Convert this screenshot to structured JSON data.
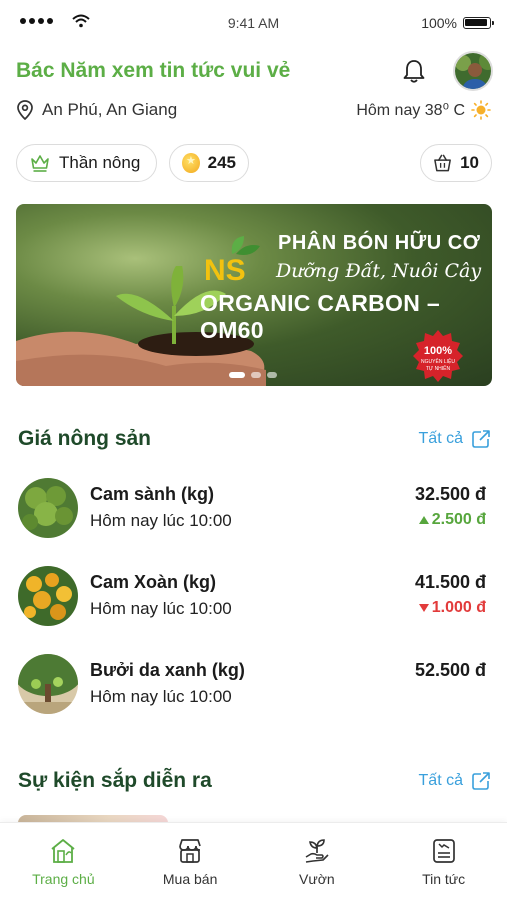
{
  "status": {
    "time": "9:41 AM",
    "battery": "100%"
  },
  "header": {
    "greeting": "Bác Năm xem tin tức vui vẻ",
    "location": "An Phú, An Giang",
    "weather": "Hôm nay 38⁰ C"
  },
  "chips": {
    "rank": "Thần nông",
    "coins": "245",
    "cart": "10"
  },
  "banner": {
    "title1": "PHÂN BÓN HỮU CƠ",
    "title2": "Dưỡng Đất, Nuôi Cây",
    "title3": "ORGANIC CARBON – OM60",
    "logo_text": "NS",
    "seal_line1": "100%",
    "seal_line2": "NGUYÊN LIỆU",
    "seal_line3": "TỰ NHIÊN",
    "active_slide": 1,
    "slides": 3
  },
  "prices": {
    "title": "Giá nông sản",
    "see_all": "Tất cả",
    "items": [
      {
        "name": "Cam sành (kg)",
        "time": "Hôm nay lúc 10:00",
        "price": "32.500 đ",
        "change": "2.500 đ",
        "direction": "up"
      },
      {
        "name": "Cam Xoàn (kg)",
        "time": "Hôm nay lúc 10:00",
        "price": "41.500 đ",
        "change": "1.000 đ",
        "direction": "down"
      },
      {
        "name": "Bưởi da xanh (kg)",
        "time": "Hôm nay lúc 10:00",
        "price": "52.500 đ",
        "change": "",
        "direction": "none"
      }
    ]
  },
  "events": {
    "title": "Sự kiện sắp diễn ra",
    "see_all": "Tất cả"
  },
  "nav": {
    "active": "home",
    "items": [
      {
        "key": "home",
        "label": "Trang chủ",
        "icon": "home-icon"
      },
      {
        "key": "market",
        "label": "Mua bán",
        "icon": "shop-icon"
      },
      {
        "key": "garden",
        "label": "Vườn",
        "icon": "plant-icon"
      },
      {
        "key": "news",
        "label": "Tin tức",
        "icon": "news-icon"
      }
    ]
  },
  "colors": {
    "brand_green": "#5cae46",
    "title_green": "#1f4a2a",
    "link_blue": "#3aa0dc",
    "up": "#57a63d",
    "down": "#e23b3b"
  }
}
